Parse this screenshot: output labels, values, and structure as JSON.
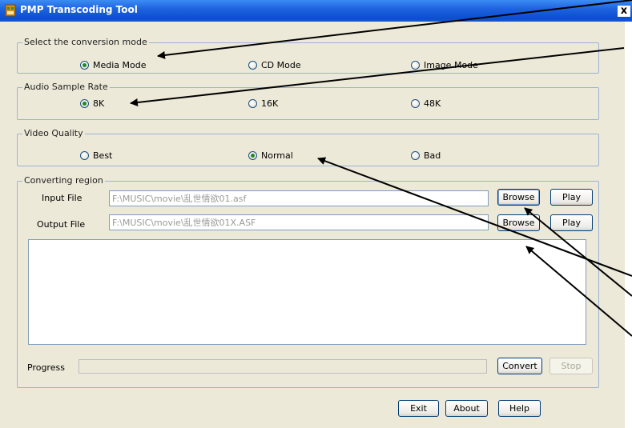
{
  "window": {
    "title": "PMP Transcoding Tool",
    "close_label": "x"
  },
  "mode_group": {
    "legend": "Select the conversion  mode",
    "options": [
      "Media Mode",
      "CD Mode",
      "Image Mode"
    ],
    "selected": "Media Mode"
  },
  "sample_group": {
    "legend": "Audio Sample Rate",
    "options": [
      "8K",
      "16K",
      "48K"
    ],
    "selected": "8K"
  },
  "quality_group": {
    "legend": "Video Quality",
    "options": [
      "Best",
      "Normal",
      "Bad"
    ],
    "selected": "Normal"
  },
  "converting": {
    "legend": "Converting region",
    "input_label": "Input File",
    "input_value": "F:\\MUSIC\\movie\\乱世情欲01.asf",
    "output_label": "Output File",
    "output_value": "F:\\MUSIC\\movie\\乱世情欲01X.ASF",
    "browse_label": "Browse",
    "play_label": "Play",
    "progress_label": "Progress",
    "convert_label": "Convert",
    "stop_label": "Stop"
  },
  "footer": {
    "exit_label": "Exit",
    "about_label": "About",
    "help_label": "Help"
  }
}
